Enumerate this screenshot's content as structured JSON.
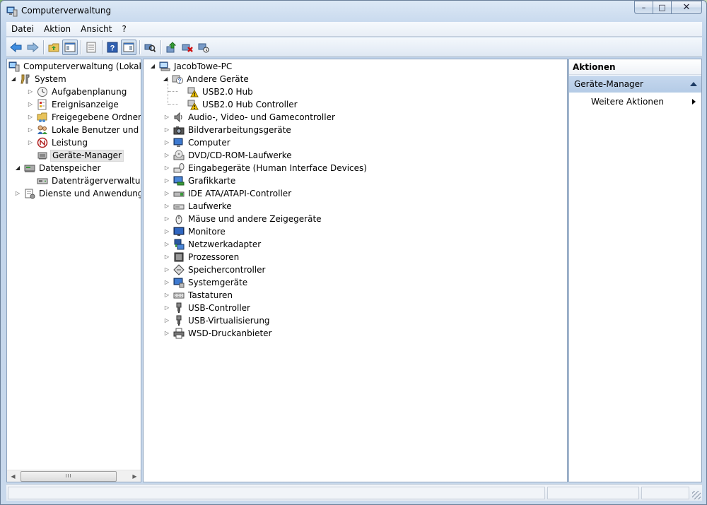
{
  "window": {
    "title": "Computerverwaltung",
    "caption": {
      "minimize": "–",
      "maximize": "□",
      "close": "✕"
    }
  },
  "menu": {
    "items": [
      "Datei",
      "Aktion",
      "Ansicht",
      "?"
    ]
  },
  "toolbar": {
    "buttons": [
      "back-arrow-icon",
      "forward-arrow-icon",
      "up-folder-icon",
      "show-hide-console-tree-icon",
      "properties-icon",
      "help-icon",
      "show-hide-action-pane-icon",
      "scan-hardware-icon",
      "update-driver-icon",
      "uninstall-icon",
      "disable-device-icon"
    ]
  },
  "left_tree": {
    "root": "Computerverwaltung (Lokal)",
    "system": "System",
    "system_children": [
      "Aufgabenplanung",
      "Ereignisanzeige",
      "Freigegebene Ordner",
      "Lokale Benutzer und Gr",
      "Leistung",
      "Geräte-Manager"
    ],
    "storage": "Datenspeicher",
    "storage_children": [
      "Datenträgerverwaltung"
    ],
    "services": "Dienste und Anwendungen",
    "scroll_thumb": "III"
  },
  "device_tree": {
    "computer": "JacobTowe-PC",
    "other_devices": "Andere Geräte",
    "other_children": [
      "USB2.0 Hub",
      "USB2.0 Hub Controller"
    ],
    "categories": [
      "Audio-, Video- und Gamecontroller",
      "Bildverarbeitungsgeräte",
      "Computer",
      "DVD/CD-ROM-Laufwerke",
      "Eingabegeräte (Human Interface Devices)",
      "Grafikkarte",
      "IDE ATA/ATAPI-Controller",
      "Laufwerke",
      "Mäuse und andere Zeigegeräte",
      "Monitore",
      "Netzwerkadapter",
      "Prozessoren",
      "Speichercontroller",
      "Systemgeräte",
      "Tastaturen",
      "USB-Controller",
      "USB-Virtualisierung",
      "WSD-Druckanbieter"
    ]
  },
  "actions": {
    "header": "Aktionen",
    "section": "Geräte-Manager",
    "more": "Weitere Aktionen"
  }
}
